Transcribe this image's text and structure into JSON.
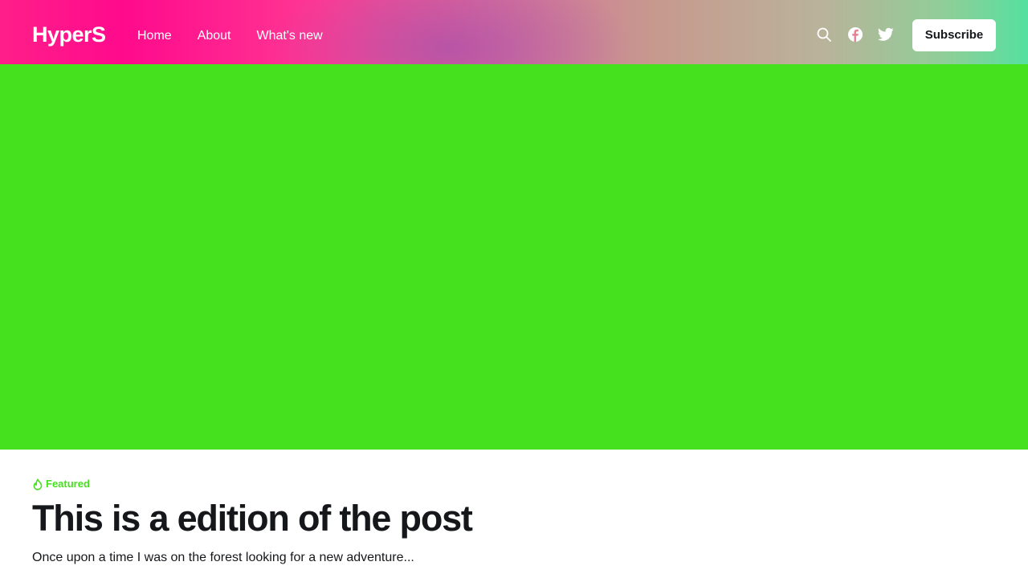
{
  "header": {
    "logo": "HyperS",
    "nav": [
      {
        "label": "Home"
      },
      {
        "label": "About"
      },
      {
        "label": "What's new"
      }
    ],
    "icons": [
      "search-icon",
      "facebook-icon",
      "twitter-icon"
    ],
    "subscribe_label": "Subscribe"
  },
  "hero": {
    "color": "#45e01e"
  },
  "post": {
    "featured_label": "Featured",
    "featured_color": "#45e01e",
    "featured_icon": "flame-icon",
    "title": "This is a edition of the post",
    "excerpt": "Once upon a time I was on the forest looking for a new adventure..."
  }
}
